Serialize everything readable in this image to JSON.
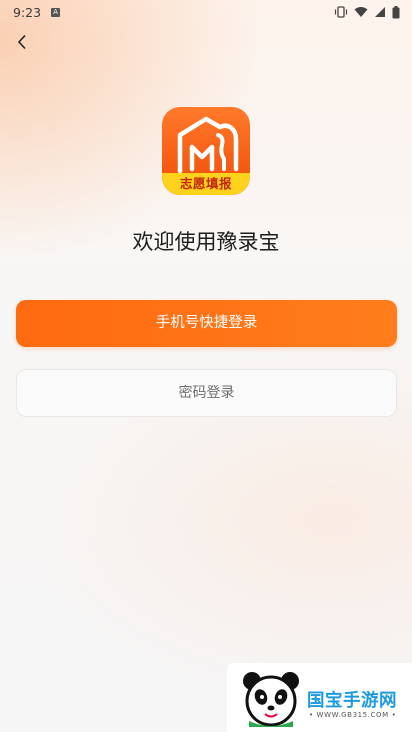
{
  "status_bar": {
    "time": "9:23",
    "notification_glyph": "A"
  },
  "nav": {
    "back_icon": "chevron-left-icon"
  },
  "logo": {
    "banner_text": "志愿填报",
    "colors": {
      "primary": "#f45a12",
      "banner": "#ffd21e"
    }
  },
  "welcome": {
    "title": "欢迎使用豫录宝"
  },
  "actions": {
    "phone_login_label": "手机号快捷登录",
    "password_login_label": "密码登录"
  },
  "watermark": {
    "brand": "国宝手游网",
    "url": "• WWW.GB315.COM •"
  },
  "colors": {
    "accent": "#ff6a10",
    "text": "#1e1e1e",
    "muted": "#6e6e6e"
  }
}
